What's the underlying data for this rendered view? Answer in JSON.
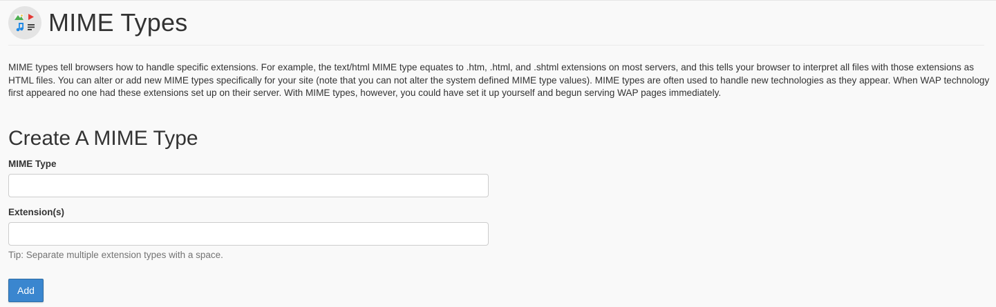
{
  "header": {
    "icon": "mime-types-icon",
    "title": "MIME Types"
  },
  "description": "MIME types tell browsers how to handle specific extensions. For example, the text/html MIME type equates to .htm, .html, and .shtml extensions on most servers, and this tells your browser to interpret all files with those extensions as HTML files. You can alter or add new MIME types specifically for your site (note that you can not alter the system defined MIME type values). MIME types are often used to handle new technologies as they appear. When WAP technology first appeared no one had these extensions set up on their server. With MIME types, however, you could have set it up yourself and begun serving WAP pages immediately.",
  "create_section": {
    "title": "Create A MIME Type",
    "mime_type": {
      "label": "MIME Type",
      "value": "",
      "placeholder": ""
    },
    "extensions": {
      "label": "Extension(s)",
      "value": "",
      "placeholder": "",
      "tip": "Tip: Separate multiple extension types with a space."
    },
    "add_button_label": "Add"
  },
  "colors": {
    "primary_button": "#3a86cf",
    "page_background": "#f9f9f9",
    "tip_text": "#737373"
  }
}
